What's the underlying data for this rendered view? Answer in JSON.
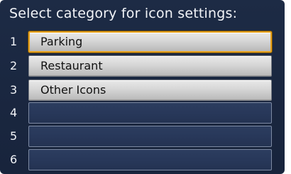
{
  "screen": {
    "title": "Select category for icon settings:"
  },
  "menu": {
    "items": [
      {
        "number": "1",
        "label": "Parking"
      },
      {
        "number": "2",
        "label": "Restaurant"
      },
      {
        "number": "3",
        "label": "Other Icons"
      },
      {
        "number": "4",
        "label": ""
      },
      {
        "number": "5",
        "label": ""
      },
      {
        "number": "6",
        "label": ""
      }
    ],
    "selected_item": "Parking"
  },
  "colors": {
    "background": "#1a2740",
    "button_face": "#d6d6d6",
    "empty_slot": "#28385a",
    "selection_border": "#e8a21c",
    "text_light": "#f2f4f8"
  }
}
